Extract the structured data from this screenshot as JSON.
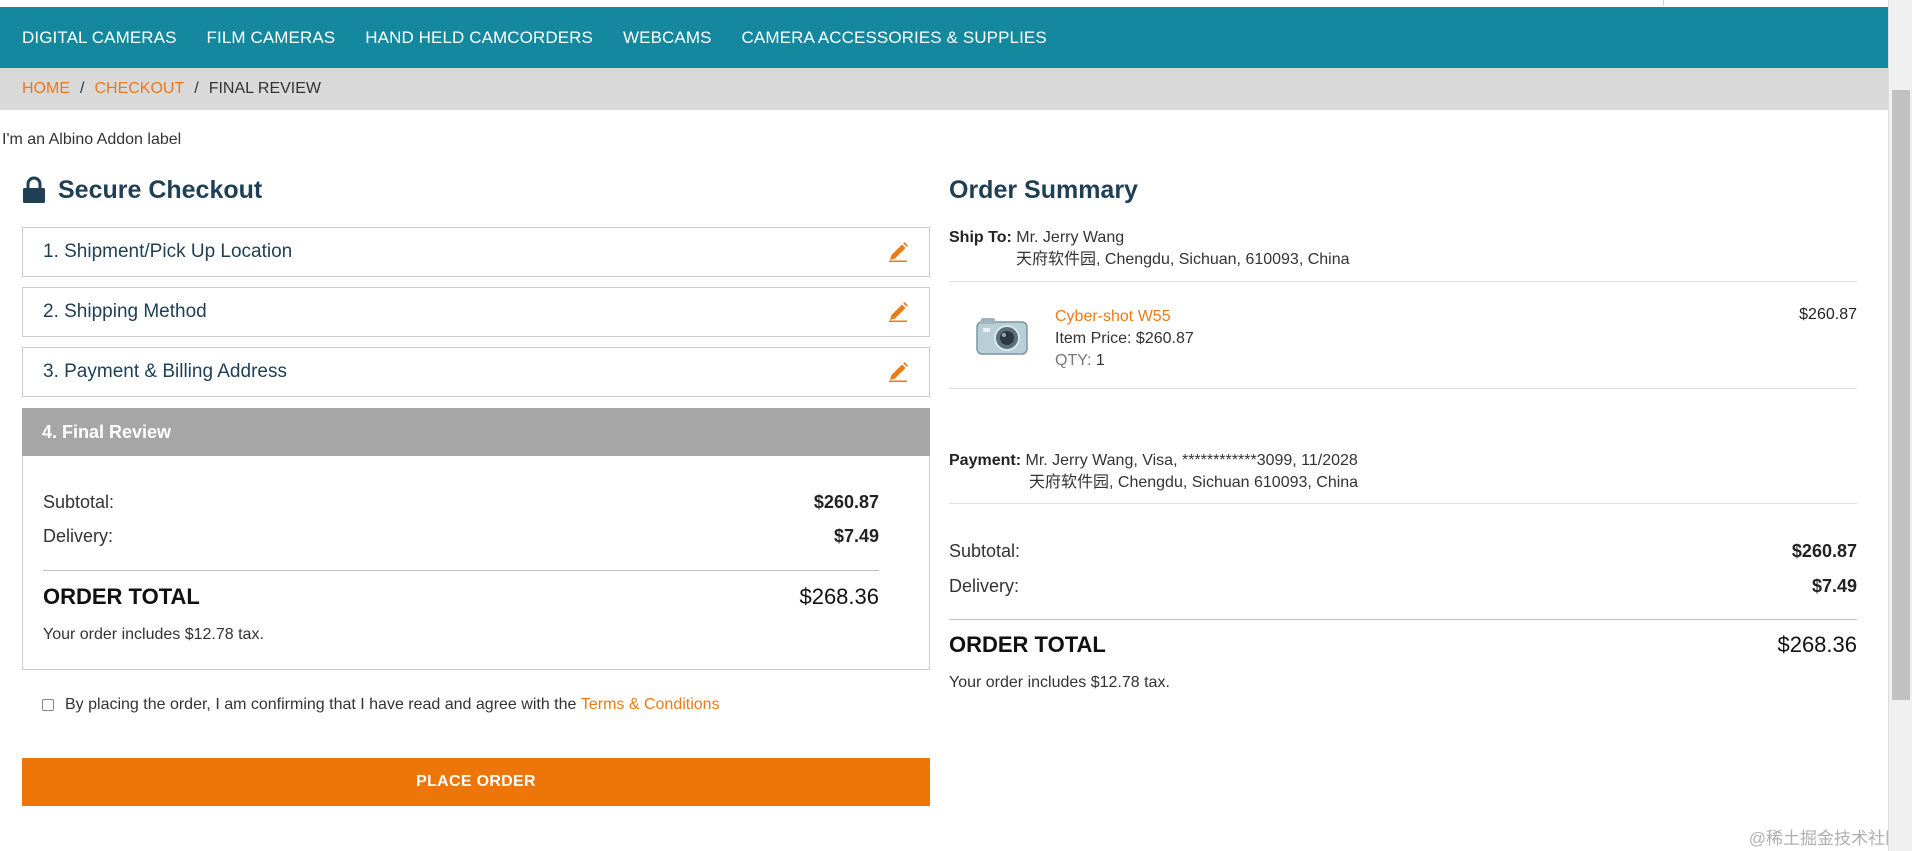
{
  "nav": {
    "items": [
      "DIGITAL CAMERAS",
      "FILM CAMERAS",
      "HAND HELD CAMCORDERS",
      "WEBCAMS",
      "CAMERA ACCESSORIES & SUPPLIES"
    ]
  },
  "breadcrumb": {
    "home": "HOME",
    "checkout": "CHECKOUT",
    "current": "FINAL REVIEW",
    "separator": "/"
  },
  "addon_label": "I'm an Albino Addon label",
  "checkout": {
    "title": "Secure Checkout",
    "steps": [
      {
        "label": "1. Shipment/Pick Up Location"
      },
      {
        "label": "2. Shipping Method"
      },
      {
        "label": "3. Payment & Billing Address"
      }
    ],
    "final_review": {
      "label": "4. Final Review",
      "subtotal_label": "Subtotal:",
      "subtotal": "$260.87",
      "delivery_label": "Delivery:",
      "delivery": "$7.49",
      "order_total_label": "ORDER TOTAL",
      "order_total": "$268.36",
      "tax_note": "Your order includes $12.78 tax."
    },
    "terms_text": "By placing the order, I am confirming that I have read and agree with the",
    "terms_link": "Terms & Conditions",
    "place_order": "PLACE ORDER"
  },
  "summary": {
    "title": "Order Summary",
    "ship_to_label": "Ship To:",
    "ship_to_name": "Mr. Jerry Wang",
    "ship_to_address": "天府软件园,  Chengdu,  Sichuan,  610093,  China",
    "item": {
      "name": "Cyber-shot W55",
      "price_label": "Item Price:",
      "price": "$260.87",
      "qty_label": "QTY:",
      "qty": "1",
      "line_total": "$260.87"
    },
    "payment_label": "Payment:",
    "payment_line1": "Mr. Jerry Wang, Visa, ************3099, 11/2028",
    "payment_line2": "天府软件园, Chengdu, Sichuan 610093, China",
    "subtotal_label": "Subtotal:",
    "subtotal": "$260.87",
    "delivery_label": "Delivery:",
    "delivery": "$7.49",
    "order_total_label": "ORDER TOTAL",
    "order_total": "$268.36",
    "tax_note": "Your order includes $12.78 tax."
  },
  "watermark": "@稀土掘金技术社区",
  "colors": {
    "nav_bg": "#13889f",
    "accent_orange": "#ee7508",
    "link_orange": "#ec7a16",
    "heading_navy": "#1e3f54",
    "breadcrumb_bg": "#d9d9d9",
    "step_active_bg": "#a6a6a6"
  },
  "icons": {
    "lock": "lock-icon",
    "edit": "pencil-icon",
    "product": "camera-icon"
  }
}
